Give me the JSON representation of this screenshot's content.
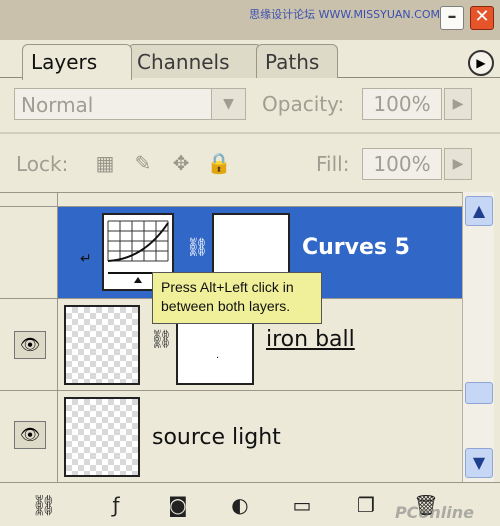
{
  "window": {
    "watermark": "思缘设计论坛 WWW.MISSYUAN.COM",
    "minimize_icon": "minimize-icon",
    "close_icon": "close-icon"
  },
  "tabs": [
    {
      "label": "Layers",
      "active": true
    },
    {
      "label": "Channels",
      "active": false
    },
    {
      "label": "Paths",
      "active": false
    }
  ],
  "options": {
    "blend_mode": "Normal",
    "opacity_label": "Opacity:",
    "opacity_value": "100%",
    "lock_label": "Lock:",
    "fill_label": "Fill:",
    "fill_value": "100%"
  },
  "layers": [
    {
      "name": "Curves 5",
      "selected": true,
      "visible": false,
      "type": "adjustment"
    },
    {
      "name": "iron ball",
      "selected": false,
      "visible": true,
      "type": "masked"
    },
    {
      "name": "source light",
      "selected": false,
      "visible": true,
      "type": "normal"
    }
  ],
  "tooltip": {
    "text": "Press Alt+Left click in between both layers."
  },
  "bottom_watermark": "PConline",
  "colors": {
    "panel_bg": "#ece9d8",
    "selection": "#3167c6",
    "tooltip_bg": "#f0ef9a"
  }
}
